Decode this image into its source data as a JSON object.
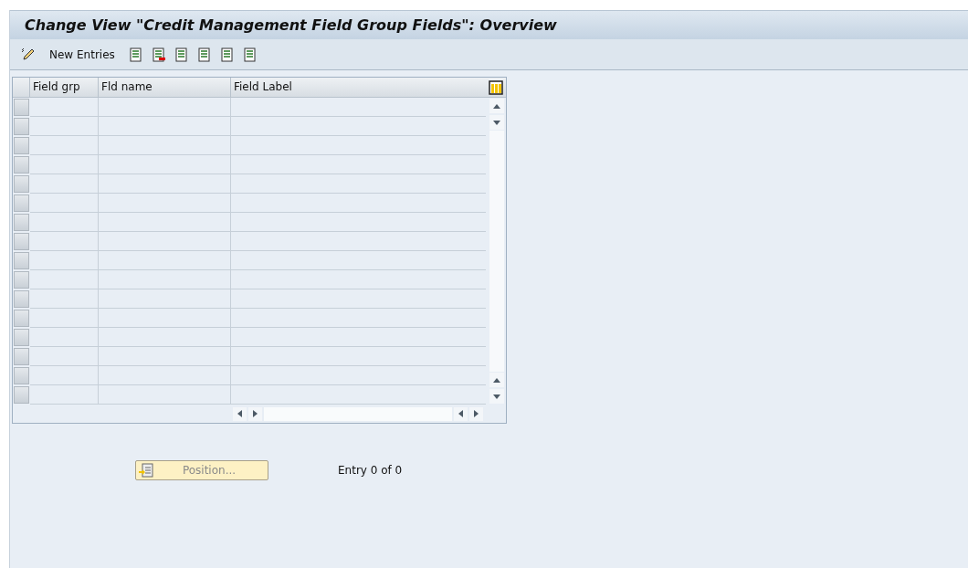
{
  "window": {
    "title": "Change View \"Credit Management Field Group Fields\": Overview"
  },
  "toolbar": {
    "new_entries": "New Entries"
  },
  "table": {
    "columns": [
      "Field grp",
      "Fld name",
      "Field Label"
    ]
  },
  "footer": {
    "position_button": {
      "label": "Position...",
      "disabled": true
    },
    "entry_count": "Entry 0 of 0"
  }
}
